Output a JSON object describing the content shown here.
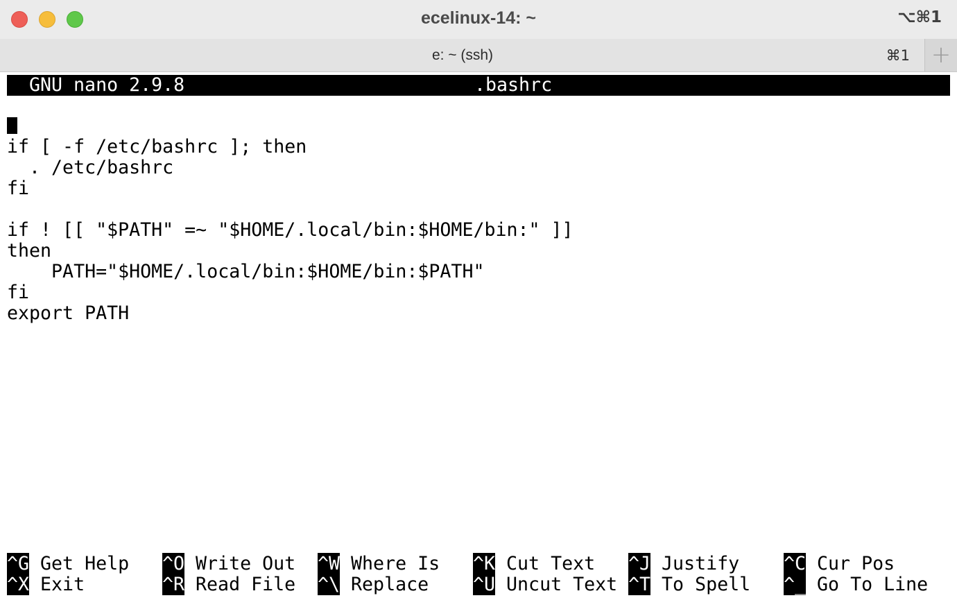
{
  "window": {
    "title": "ecelinux-14: ~",
    "shortcut": "⌥⌘1"
  },
  "tab": {
    "title": "e: ~ (ssh)",
    "shortcut": "⌘1",
    "new_tab": "+"
  },
  "nano": {
    "version": "GNU nano 2.9.8",
    "filename": ".bashrc",
    "lines": [
      "",
      "if [ -f /etc/bashrc ]; then",
      "  . /etc/bashrc",
      "fi",
      "",
      "if ! [[ \"$PATH\" =~ \"$HOME/.local/bin:$HOME/bin:\" ]]",
      "then",
      "    PATH=\"$HOME/.local/bin:$HOME/bin:$PATH\"",
      "fi",
      "export PATH"
    ],
    "shortcuts": [
      {
        "key": "^G",
        "label": "Get Help"
      },
      {
        "key": "^O",
        "label": "Write Out"
      },
      {
        "key": "^W",
        "label": "Where Is"
      },
      {
        "key": "^K",
        "label": "Cut Text"
      },
      {
        "key": "^J",
        "label": "Justify"
      },
      {
        "key": "^C",
        "label": "Cur Pos"
      },
      {
        "key": "^X",
        "label": "Exit"
      },
      {
        "key": "^R",
        "label": "Read File"
      },
      {
        "key": "^\\",
        "label": "Replace"
      },
      {
        "key": "^U",
        "label": "Uncut Text"
      },
      {
        "key": "^T",
        "label": "To Spell"
      },
      {
        "key": "^_",
        "label": "Go To Line"
      }
    ]
  }
}
